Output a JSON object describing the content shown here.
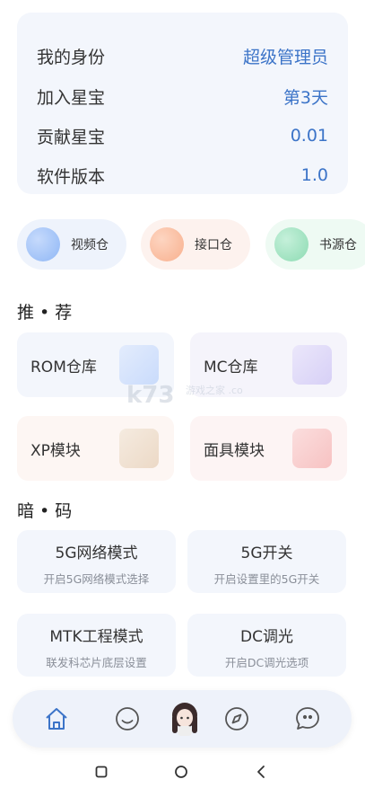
{
  "info": {
    "rows": [
      {
        "label": "我的身份",
        "value": "超级管理员"
      },
      {
        "label": "加入星宝",
        "value": "第3天"
      },
      {
        "label": "贡献星宝",
        "value": "0.01"
      },
      {
        "label": "软件版本",
        "value": "1.0"
      }
    ]
  },
  "chips": [
    {
      "label": "视频仓",
      "color": "#8fb7f5"
    },
    {
      "label": "接口仓",
      "color": "#f8b08e"
    },
    {
      "label": "书源仓",
      "color": "#8ddbb3"
    }
  ],
  "sections": {
    "recommend": "推 • 荐",
    "secret": "暗 • 码"
  },
  "recommend": [
    {
      "label": "ROM仓库",
      "bg": "#f3f6fc",
      "thumb": "#c9dbfb"
    },
    {
      "label": "MC仓库",
      "bg": "#f5f4fb",
      "thumb": "#d7d0f6"
    },
    {
      "label": "XP模块",
      "bg": "#fdf6f3",
      "thumb": "#ecd9c6"
    },
    {
      "label": "面具模块",
      "bg": "#fdf4f4",
      "thumb": "#f7c2c2"
    }
  ],
  "codes": [
    {
      "title": "5G网络模式",
      "sub": "开启5G网络模式选择"
    },
    {
      "title": "5G开关",
      "sub": "开启设置里的5G开关"
    },
    {
      "title": "MTK工程模式",
      "sub": "联发科芯片底层设置"
    },
    {
      "title": "DC调光",
      "sub": "开启DC调光选项"
    }
  ],
  "nav": {
    "items": [
      "home-icon",
      "smile-icon",
      "avatar-icon",
      "compass-icon",
      "chat-icon"
    ],
    "accent": "#3c74c8"
  },
  "watermark": {
    "text": "k73",
    "sub": "游戏之家 .com"
  }
}
